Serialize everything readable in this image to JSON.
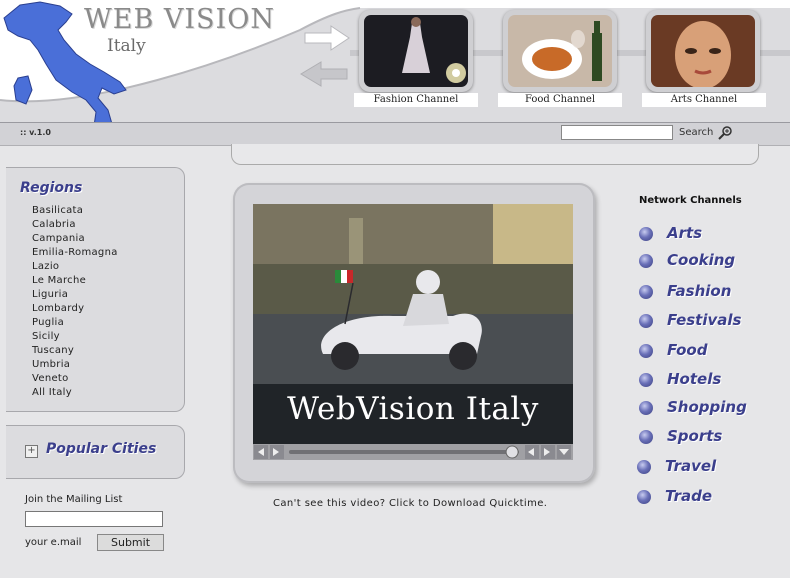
{
  "logo": {
    "title": "WEB VISION",
    "subtitle": "Italy"
  },
  "channels": [
    {
      "label": "Fashion Channel"
    },
    {
      "label": "Food Channel"
    },
    {
      "label": "Arts Channel"
    }
  ],
  "toolbar": {
    "version": ":: v.1.0",
    "search_label": "Search",
    "search_value": ""
  },
  "regions": {
    "title": "Regions",
    "items": [
      "Basilicata",
      "Calabria",
      "Campania",
      "Emilia-Romagna",
      "Lazio",
      "Le Marche",
      "Liguria",
      "Lombardy",
      "Puglia",
      "Sicily",
      "Tuscany",
      "Umbria",
      "Veneto",
      "All Italy"
    ]
  },
  "popular_cities": {
    "title": "Popular Cities"
  },
  "mailing": {
    "label": "Join the Mailing List",
    "email_label": "your e.mail",
    "submit_label": "Submit",
    "value": ""
  },
  "video": {
    "title": "WebVision Italy",
    "download_text": "Can't see this video? Click to Download Quicktime.",
    "progress": 0.97
  },
  "network": {
    "title": "Network Channels",
    "items": [
      "Arts",
      "Cooking",
      "Fashion",
      "Festivals",
      "Food",
      "Hotels",
      "Shopping",
      "Sports",
      "Travel",
      "Trade"
    ]
  },
  "colors": {
    "accent": "#3b3f8c",
    "map": "#4a6fd8",
    "background": "#e6e6e8"
  }
}
